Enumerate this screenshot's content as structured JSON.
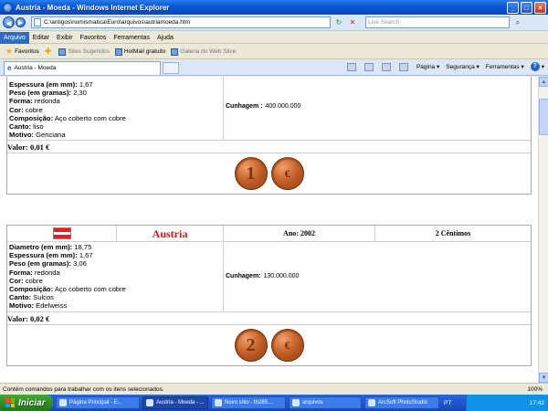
{
  "window": {
    "title": "Austria - Moeda - Windows Internet Explorer"
  },
  "address": {
    "url": "C:\\antigos\\numismatica\\Euro\\arquivos\\autriamoeda.htm",
    "search_placeholder": "Live Search"
  },
  "menu": {
    "items": [
      "Arquivo",
      "Editar",
      "Exibir",
      "Favoritos",
      "Ferramentas",
      "Ajuda"
    ]
  },
  "favorites": {
    "label": "Favoritos",
    "items": [
      "Sites Sugeridos",
      "HotMail gratuito",
      "Galeria do Web Slice"
    ]
  },
  "tab": {
    "title": "Austria - Moeda"
  },
  "tools": {
    "pagina": "Página",
    "seguranca": "Segurança",
    "ferramentas": "Ferramentas"
  },
  "coin1": {
    "specs": [
      {
        "label": "Espessura (em mm):",
        "value": "1,67"
      },
      {
        "label": "Peso (em gramas):",
        "value": "2,30"
      },
      {
        "label": "Forma:",
        "value": "redonda"
      },
      {
        "label": "Cor:",
        "value": "cobre"
      },
      {
        "label": "Composição:",
        "value": "Aço coberto com cobre"
      },
      {
        "label": "Canto:",
        "value": "liso"
      },
      {
        "label": "Motivo:",
        "value": "Genciana"
      }
    ],
    "mintage_label": "Cunhagem :",
    "mintage_value": "400.000.000",
    "value_text": "Valor: 0,01 €",
    "obverse_numeral": "1",
    "reverse_symbol": "€"
  },
  "coin2": {
    "country": "Austria",
    "year": "Ano: 2002",
    "denomination": "2 Cêntimos",
    "specs": [
      {
        "label": "Diametro (em mm):",
        "value": "18,75"
      },
      {
        "label": "Espessura (em mm):",
        "value": "1,67"
      },
      {
        "label": "Peso (em gramas):",
        "value": "3,06"
      },
      {
        "label": "Forma:",
        "value": "redonda"
      },
      {
        "label": "Cor:",
        "value": "cobre"
      },
      {
        "label": "Composição:",
        "value": "Aço coberto com cobre"
      },
      {
        "label": "Canto:",
        "value": "Sulcos"
      },
      {
        "label": "Motivo:",
        "value": "Edelweiss"
      }
    ],
    "mintage_label": "Cunhagem:",
    "mintage_value": "130.000.000",
    "value_text": "Valor: 0,02 €",
    "obverse_numeral": "2",
    "reverse_symbol": "€"
  },
  "status": {
    "message": "Contém comandos para trabalhar com os itens selecionados.",
    "zoom": "100%"
  },
  "taskbar": {
    "start": "Iniciar",
    "tasks": [
      "Página Principal - E...",
      "Austria - Moeda - ...",
      "Novo sítio - th285....",
      "arquivos",
      "ArcSoft PhotoStudio"
    ],
    "lang": "PT",
    "clock": "17:42"
  },
  "colors": {
    "title_blue": "#0a5ad6",
    "country_red": "#d11111",
    "coin_copper": "#c6622a"
  }
}
